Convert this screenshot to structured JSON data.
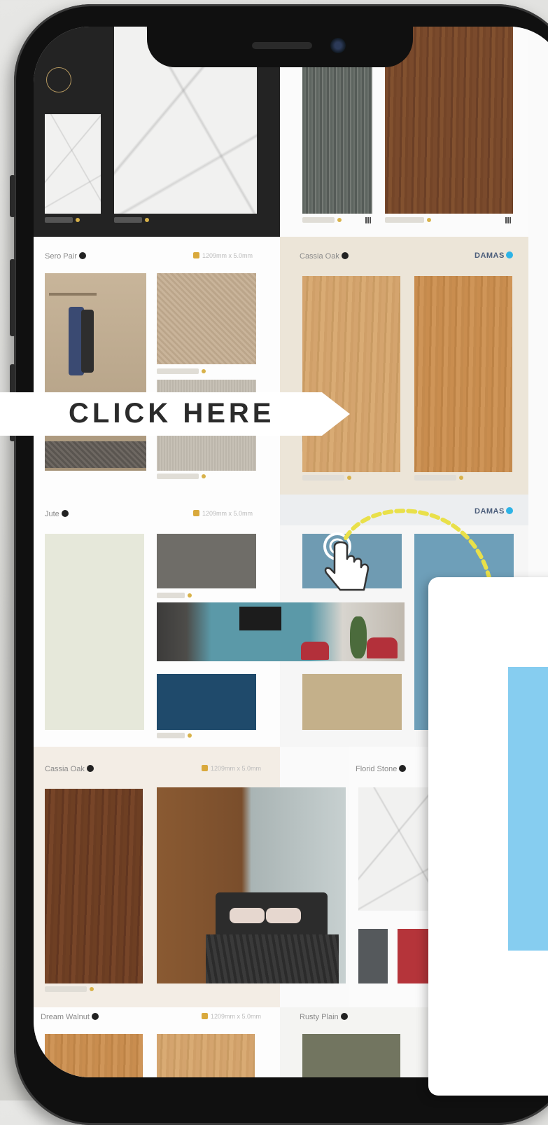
{
  "cta": {
    "label": "CLICK HERE"
  },
  "brand": {
    "name": "DAMAS"
  },
  "sections": [
    {
      "label": "Sero Pair",
      "code": "1209mm x 5.0mm"
    },
    {
      "label": "Cassia Oak",
      "code": ""
    },
    {
      "label": "Jute",
      "code": "1209mm x 5.0mm"
    },
    {
      "label": "Cassia Oak",
      "code": "1209mm x 5.0mm"
    },
    {
      "label": "Florid Stone",
      "code": ""
    },
    {
      "label": "Dream Walnut",
      "code": "1209mm x 5.0mm"
    },
    {
      "label": "Rusty Plain",
      "code": ""
    }
  ],
  "colors": {
    "accent_yellow": "#e9e04a",
    "popup_blue": "#86cdf0"
  },
  "icons": [
    "tap-hand-icon",
    "curved-arrow-icon"
  ]
}
